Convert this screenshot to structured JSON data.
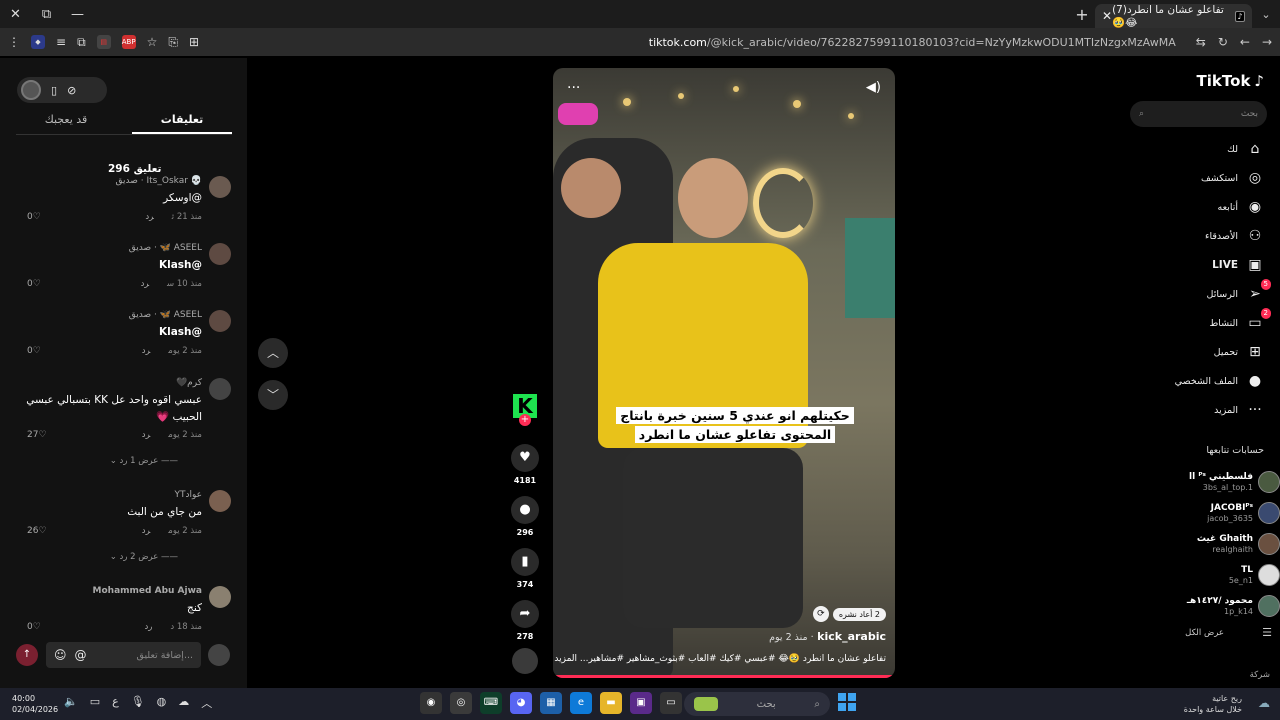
{
  "tab": {
    "title": "(7)تفاعلو عشان ما انطرد🥹😂"
  },
  "window": {
    "minimize": "—",
    "maximize": "⧉",
    "close": "✕",
    "new_tab": "+",
    "tab_menu": "⌄"
  },
  "address": {
    "domain": "tiktok.com",
    "path": "/@kick_arabic/video/7622827599110180103?cid=NzYyMzkwODU1MTIzNzgxMzAwMA"
  },
  "video": {
    "caption_line1": "حكيتلهم انو عندي 5 سنين خبرة بانتاج",
    "caption_line2": "المحتوى تفاعلو عشان ما انطرد",
    "author": "kick_arabic",
    "time": "منذ 2 يوم",
    "description": "تفاعلو عشان ما انطرد 🥹😂 #عبسي #كيك #العاب #بثوث_مشاهير #مشاهير... المزيد",
    "repost": "2 أعاد نشره",
    "more": "···"
  },
  "actions": {
    "likes": "4181",
    "comments": "296",
    "saves": "374",
    "shares": "278"
  },
  "comments_panel": {
    "tab_comments": "تعليقات",
    "tab_you_may_like": "قد يعجبك",
    "count": "296 تعليق",
    "input_placeholder": "إضافة تعليق...",
    "at_symbol": "@",
    "emoji": "☺",
    "reply_label": "رد",
    "items": [
      {
        "user": "💀 Its_Oskar · صديق",
        "text": "@اوسكر",
        "time": "منذ 21 ث",
        "likes": "0"
      },
      {
        "user": "ASEEL 🦋 · صديق",
        "text": "@Klash",
        "time": "منذ 10 س",
        "likes": "0"
      },
      {
        "user": "ASEEL 🦋 · صديق",
        "text": "@Klash",
        "time": "منذ 2 يوم",
        "likes": "0"
      },
      {
        "user": "كرم🖤",
        "text": "عبسي اقوه واحد عل KK بتسبالي عبسي",
        "text2": "الحبيب 💗",
        "time": "منذ 2 يوم",
        "likes": "27",
        "view_replies": "عرض 1 رد"
      },
      {
        "user": "عوادYT",
        "text": "من جاي من البث",
        "time": "منذ 2 يوم",
        "likes": "26",
        "view_replies": "عرض 2 رد"
      },
      {
        "user": "Mohammed Abu Ajwa",
        "text": "كنج",
        "time": "منذ 18 د",
        "likes": "0"
      }
    ]
  },
  "sidebar": {
    "logo": "TikTok",
    "search_placeholder": "بحث",
    "nav": [
      {
        "label": "لك",
        "icon": "home-icon"
      },
      {
        "label": "استكشف",
        "icon": "compass-icon"
      },
      {
        "label": "أتابعه",
        "icon": "following-icon"
      },
      {
        "label": "الأصدقاء",
        "icon": "friends-icon"
      },
      {
        "label": "LIVE",
        "icon": "live-icon"
      },
      {
        "label": "الرسائل",
        "icon": "messages-icon",
        "badge": "5"
      },
      {
        "label": "النشاط",
        "icon": "activity-icon",
        "badge": "2"
      },
      {
        "label": "تحميل",
        "icon": "upload-icon"
      },
      {
        "label": "الملف الشخصي",
        "icon": "profile-icon"
      },
      {
        "label": "المزيد",
        "icon": "more-icon"
      }
    ],
    "following_title": "حسابات تتابعها",
    "following": [
      {
        "name": "فلسطيني ll ᴾˢ",
        "handle": "3bs_al_top.1"
      },
      {
        "name": "JACOBIᴾˢ",
        "handle": "jacob_3635"
      },
      {
        "name": "Ghaith غيث",
        "handle": "realghaith"
      },
      {
        "name": "TL",
        "handle": "5e_n1"
      },
      {
        "name": "محمود /١٤٢٧هـ",
        "handle": "1p_k14"
      }
    ],
    "see_all": "عرض الكل",
    "company": "شركة"
  },
  "taskbar": {
    "time": "40:00",
    "date": "02/04/2026",
    "search": "بحث",
    "weather_line1": "ريح عاتية",
    "weather_line2": "خلال ساعة واحدة",
    "lang": "ع"
  }
}
